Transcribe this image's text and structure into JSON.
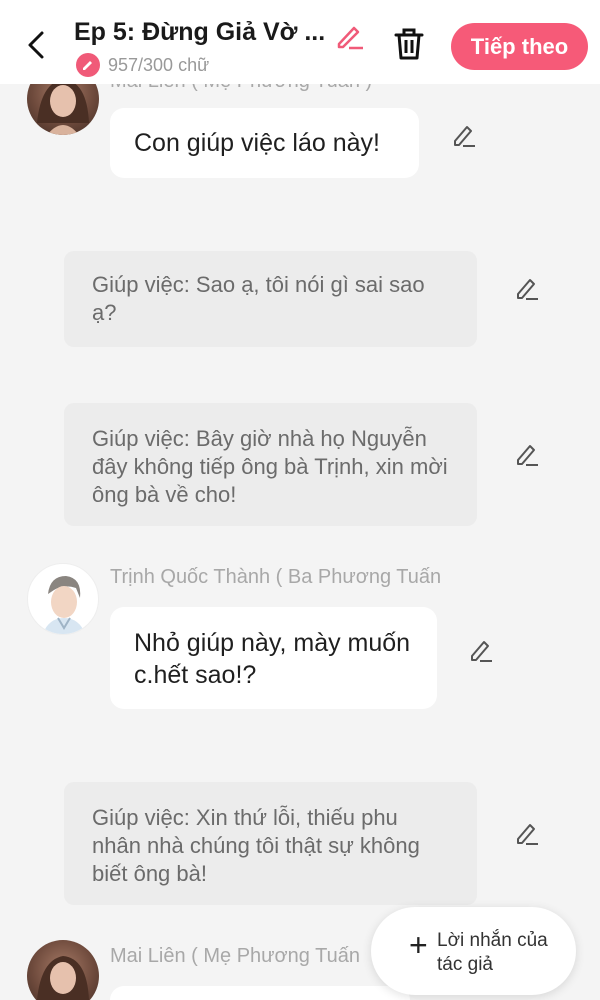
{
  "header": {
    "title": "Ep 5: Đừng Giả Vờ ...",
    "word_count": "957/300 chữ",
    "next_label": "Tiếp theo"
  },
  "messages": [
    {
      "speaker": "Mai Liên ( Mẹ Phương Tuấn )",
      "text": "Con giúp việc láo này!"
    },
    {
      "text": "Giúp việc: Sao ạ, tôi nói gì sai sao ạ?"
    },
    {
      "text": "Giúp việc: Bây giờ nhà họ Nguyễn đây không tiếp ông bà Trịnh, xin mời ông bà về cho!"
    },
    {
      "speaker": "Trịnh Quốc Thành ( Ba Phương Tuấn",
      "text": "Nhỏ giúp này, mày muốn c.hết sao!?"
    },
    {
      "text": "Giúp việc: Xin thứ lỗi, thiếu phu nhân nhà chúng tôi thật sự không biết ông bà!"
    },
    {
      "speaker": "Mai Liên ( Mẹ Phương Tuấn"
    }
  ],
  "author_note": {
    "label": "Lời nhắn của tác giả"
  },
  "colors": {
    "accent": "#f65a78",
    "background": "#f4f4f4",
    "narration_bg": "#ececec"
  }
}
